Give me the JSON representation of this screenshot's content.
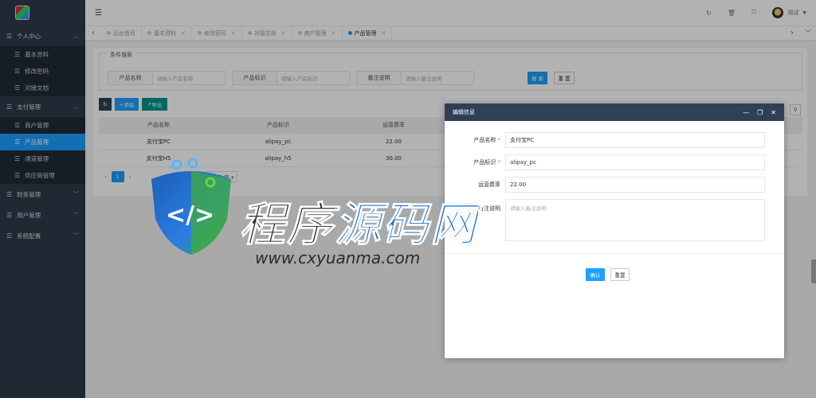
{
  "sidebar": {
    "groups": [
      {
        "label": "个人中心",
        "expanded": true,
        "items": [
          "基本资料",
          "修改密码",
          "对接文档"
        ]
      },
      {
        "label": "支付管理",
        "expanded": true,
        "items": [
          "商户管理",
          "产品管理",
          "通道管理",
          "供应商管理"
        ]
      },
      {
        "label": "财务管理",
        "expanded": false
      },
      {
        "label": "用户管理",
        "expanded": false
      },
      {
        "label": "系统配置",
        "expanded": false
      }
    ],
    "active_item": "产品管理"
  },
  "topbar": {
    "user": "测试"
  },
  "tabs": [
    {
      "label": "后台首页",
      "active": false
    },
    {
      "label": "基本资料",
      "active": false
    },
    {
      "label": "修改密码",
      "active": false
    },
    {
      "label": "对接文档",
      "active": false
    },
    {
      "label": "商户管理",
      "active": false
    },
    {
      "label": "产品管理",
      "active": true
    }
  ],
  "search": {
    "title": "条件搜索",
    "fields": [
      {
        "label": "产品名称",
        "placeholder": "请输入产品名称"
      },
      {
        "label": "产品标识",
        "placeholder": "请输入产品标识"
      },
      {
        "label": "备注说明",
        "placeholder": "请输入备注说明"
      }
    ],
    "search_btn": "搜 索",
    "reset_btn": "重 置"
  },
  "toolbar": {
    "refresh_icon": "refresh-icon",
    "add": "+添加",
    "export": "导出"
  },
  "table": {
    "headers": [
      "产品名称",
      "产品标识",
      "运营费率"
    ],
    "rows": [
      [
        "支付宝PC",
        "alipay_pc",
        "22.00"
      ],
      [
        "支付宝H5",
        "alipay_h5",
        "30.00"
      ]
    ]
  },
  "pager": {
    "current": "1",
    "total": "共 2 条",
    "page_size": "15 条/页"
  },
  "modal": {
    "title": "编辑信息",
    "fields": [
      {
        "label": "产品名称",
        "required": "*",
        "value": "支付宝PC"
      },
      {
        "label": "产品标识",
        "required": "*",
        "value": "alipay_pc"
      },
      {
        "label": "运营费率",
        "value": "22.00"
      },
      {
        "label": "备注说明",
        "placeholder": "请输入备注说明"
      }
    ],
    "confirm_btn": "确认",
    "reset_btn": "重置"
  },
  "watermark": {
    "title": "程序源码网",
    "url": "www.cxyuanma.com"
  },
  "colors": {
    "sidebar": "#2f3a4a",
    "accent": "#1e9fff",
    "modal_header": "#2f4056",
    "success": "#009688"
  }
}
